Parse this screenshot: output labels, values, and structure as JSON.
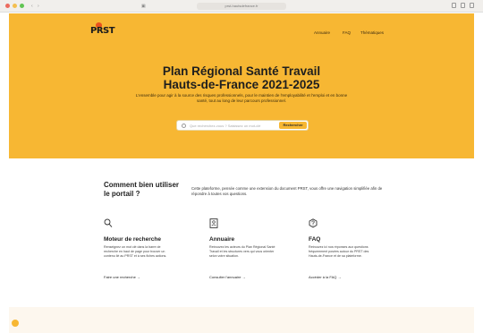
{
  "browser": {
    "url": "prst-hautsdefrance.fr",
    "colors": {
      "close": "#ec6b5e",
      "minimize": "#f4bf4f",
      "maximize": "#61c554"
    }
  },
  "header": {
    "logo_text": "PRST",
    "nav": [
      "Annuaire",
      "FAQ",
      "Thématiques"
    ]
  },
  "hero": {
    "title_line1": "Plan Régional Santé Travail",
    "title_line2": "Hauts-de-France 2021-2025",
    "lead": "L'ensemble pour agir à la source des risques professionnels, pour le maintien de l'employabilité et l'emploi et en bonne santé, tout au long de leur parcours professionnel.",
    "search_placeholder": "Que recherchez-vous ? Saisissez un mot-clé",
    "search_button": "Rechercher",
    "background": "#f7b733"
  },
  "portal": {
    "title": "Comment bien utiliser le portail ?",
    "description": "Cette plateforme, pensée comme une extension du document PRST, vous offre une navigation simplifiée afin de répondre à toutes vos questions."
  },
  "cards": [
    {
      "icon": "magnifier-icon",
      "title": "Moteur de recherche",
      "text": "Renseignez un mot clé dans la barre de recherche en haut de page pour trouver un contenu lié au PRST et à ses fiches actions.",
      "link": "Faire une recherche →"
    },
    {
      "icon": "directory-icon",
      "title": "Annuaire",
      "text": "Retrouvez les acteurs du Plan Régional Santé Travail et les structures vers qui vous orienter selon votre situation.",
      "link": "Consulter l'annuaire →"
    },
    {
      "icon": "question-icon",
      "title": "FAQ",
      "text": "Retrouvez ici nos réponses aux questions fréquemment posées autour du PRST des Hauts-de-France et de sa plateforme.",
      "link": "Accéder à la FAQ →"
    }
  ]
}
